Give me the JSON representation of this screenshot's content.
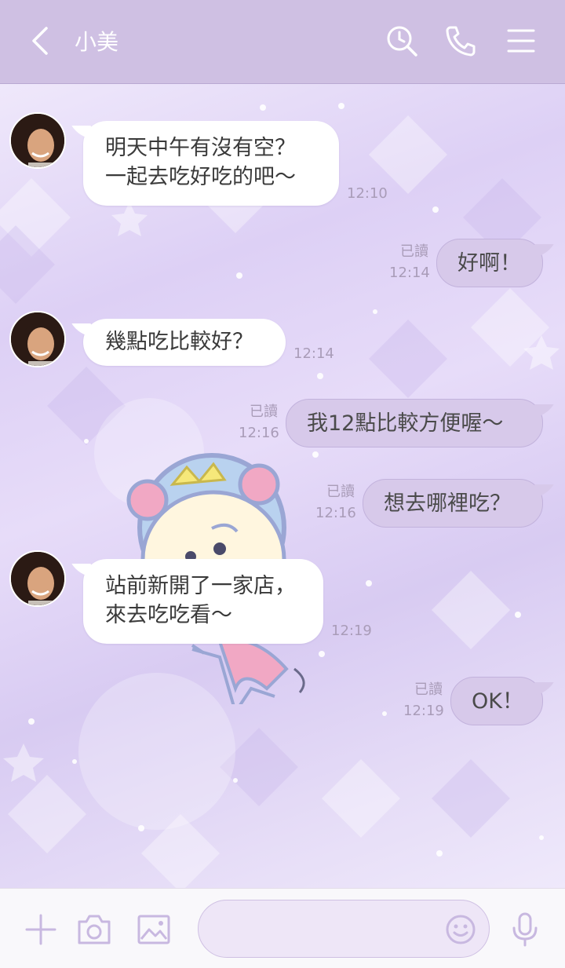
{
  "header": {
    "title": "小美"
  },
  "messages": [
    {
      "side": "in",
      "lines": [
        "明天中午有沒有空？",
        "一起去吃好吃的吧～"
      ],
      "time": "12:10"
    },
    {
      "side": "out",
      "text": "好啊！",
      "read": "已讀",
      "time": "12:14"
    },
    {
      "side": "in",
      "lines": [
        "幾點吃比較好？"
      ],
      "time": "12:14"
    },
    {
      "side": "out",
      "text": "我12點比較方便喔～",
      "read": "已讀",
      "time": "12:16"
    },
    {
      "side": "out",
      "text": "想去哪裡吃？",
      "read": "已讀",
      "time": "12:16"
    },
    {
      "side": "in",
      "lines": [
        "站前新開了一家店，",
        "來去吃吃看～"
      ],
      "time": "12:19"
    },
    {
      "side": "out",
      "text": "OK！",
      "read": "已讀",
      "time": "12:19"
    }
  ],
  "input": {
    "placeholder": ""
  },
  "icons": {
    "back": "chevron-left-icon",
    "search": "search-clock-icon",
    "call": "phone-icon",
    "menu": "hamburger-menu-icon",
    "add": "plus-icon",
    "camera": "camera-icon",
    "image": "image-icon",
    "emoji": "emoji-icon",
    "mic": "microphone-icon"
  },
  "colors": {
    "header": "#cfc0e3",
    "outgoing_bubble": "#d7c9ea",
    "incoming_bubble": "#ffffff",
    "icon": "#ffffff"
  }
}
